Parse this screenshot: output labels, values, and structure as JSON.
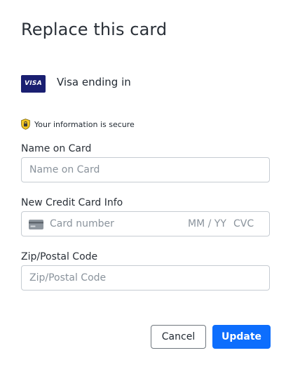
{
  "dialog": {
    "title": "Replace this card"
  },
  "current_card": {
    "brand_badge": "VISA",
    "description": "Visa ending in"
  },
  "security": {
    "icon": "lock-icon",
    "text": "Your information is secure"
  },
  "form": {
    "name_on_card": {
      "label": "Name on Card",
      "placeholder": "Name on Card",
      "value": ""
    },
    "card_info": {
      "label": "New Credit Card Info",
      "card_number_placeholder": "Card number",
      "expiry_placeholder": "MM / YY",
      "cvc_placeholder": "CVC",
      "icon": "credit-card-icon"
    },
    "zip": {
      "label": "Zip/Postal Code",
      "placeholder": "Zip/Postal Code",
      "value": ""
    }
  },
  "buttons": {
    "cancel": "Cancel",
    "update": "Update"
  },
  "colors": {
    "primary": "#0d6efd",
    "visa_brand": "#1a1f71",
    "lock_badge": "#f3c623",
    "input_border": "#c6ccd2",
    "placeholder": "#8a939c"
  }
}
